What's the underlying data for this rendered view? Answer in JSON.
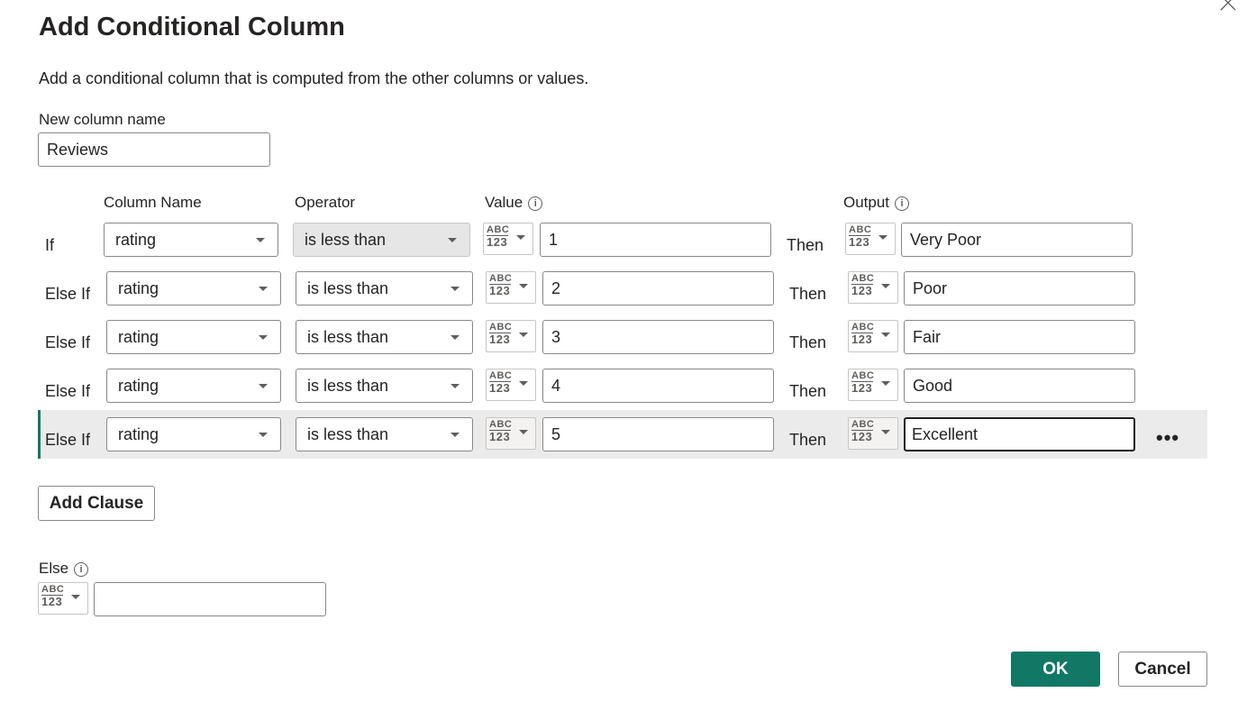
{
  "dialog": {
    "title": "Add Conditional Column",
    "description": "Add a conditional column that is computed from the other columns or values."
  },
  "new_column": {
    "label": "New column name",
    "value": "Reviews"
  },
  "headers": {
    "column_name": "Column Name",
    "operator": "Operator",
    "value": "Value",
    "output": "Output"
  },
  "type_icon": {
    "line1": "ABC",
    "line2": "123"
  },
  "icons": {
    "info": "i",
    "more": "•••"
  },
  "clauses": [
    {
      "prefix": "If",
      "column": "rating",
      "operator": "is less than",
      "value": "1",
      "then": "Then",
      "output": "Very Poor"
    },
    {
      "prefix": "Else If",
      "column": "rating",
      "operator": "is less than",
      "value": "2",
      "then": "Then",
      "output": "Poor"
    },
    {
      "prefix": "Else If",
      "column": "rating",
      "operator": "is less than",
      "value": "3",
      "then": "Then",
      "output": "Fair"
    },
    {
      "prefix": "Else If",
      "column": "rating",
      "operator": "is less than",
      "value": "4",
      "then": "Then",
      "output": "Good"
    },
    {
      "prefix": "Else If",
      "column": "rating",
      "operator": "is less than",
      "value": "5",
      "then": "Then",
      "output": "Excellent"
    }
  ],
  "add_clause_label": "Add Clause",
  "else": {
    "label": "Else",
    "value": ""
  },
  "buttons": {
    "ok": "OK",
    "cancel": "Cancel"
  },
  "colors": {
    "accent": "#117865",
    "selected_row": "#ebebeb"
  }
}
